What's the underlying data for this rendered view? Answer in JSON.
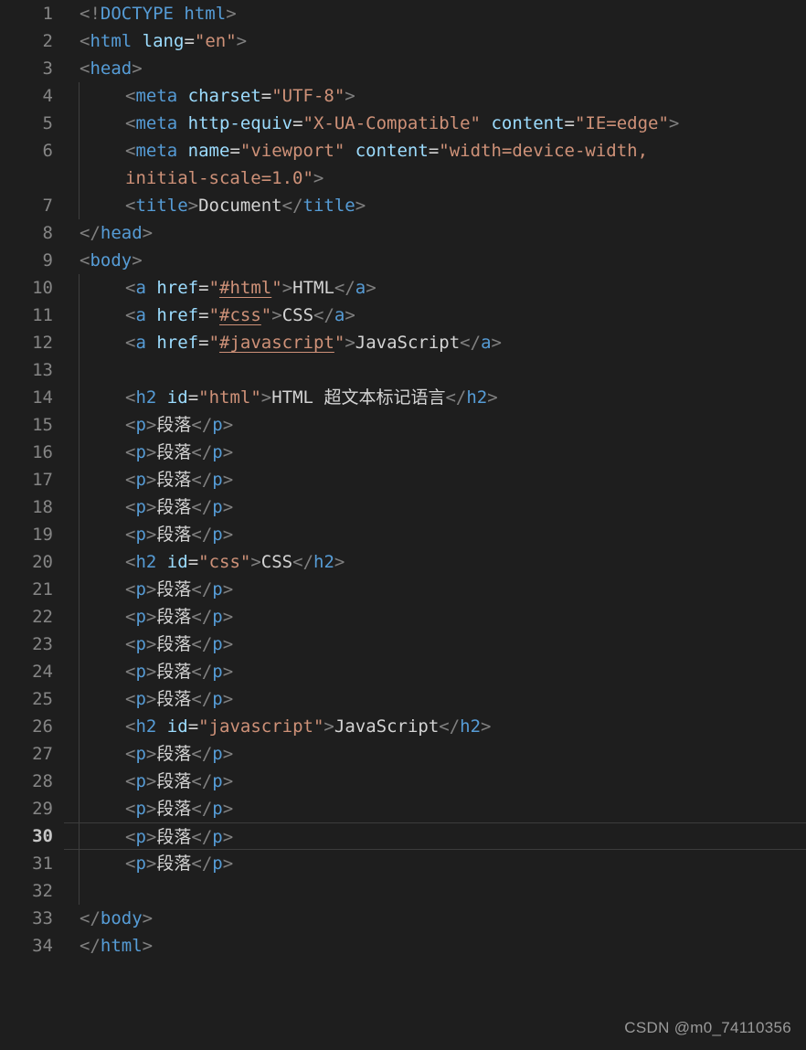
{
  "editor": {
    "language": "html",
    "theme": "dark-plus",
    "background_color": "#1e1e1e",
    "line_number_color": "#858585",
    "active_line_number_color": "#c6c6c6",
    "active_line": 30,
    "total_lines": 34,
    "indent_guide_color": "#404040",
    "colors": {
      "punctuation": "#808080",
      "tag": "#569cd6",
      "attribute": "#9cdcfe",
      "string": "#ce9178",
      "text": "#d4d4d4"
    }
  },
  "watermark": {
    "text": "CSDN @m0_74110356"
  },
  "lines": [
    {
      "n": "1",
      "indent": 0,
      "text": "<!DOCTYPE html>"
    },
    {
      "n": "2",
      "indent": 0,
      "text": "<html lang=\"en\">"
    },
    {
      "n": "3",
      "indent": 0,
      "text": "<head>"
    },
    {
      "n": "4",
      "indent": 1,
      "text": "    <meta charset=\"UTF-8\">"
    },
    {
      "n": "5",
      "indent": 1,
      "text": "    <meta http-equiv=\"X-UA-Compatible\" content=\"IE=edge\">"
    },
    {
      "n": "6",
      "indent": 1,
      "text": "    <meta name=\"viewport\" content=\"width=device-width, initial-scale=1.0\">",
      "wrapped": true,
      "wrap_part_1": "    <meta name=\"viewport\" content=\"width=device-width,",
      "wrap_part_2": "initial-scale=1.0\">"
    },
    {
      "n": "7",
      "indent": 1,
      "text": "    <title>Document</title>"
    },
    {
      "n": "8",
      "indent": 0,
      "text": "</head>"
    },
    {
      "n": "9",
      "indent": 0,
      "text": "<body>"
    },
    {
      "n": "10",
      "indent": 1,
      "text": "    <a href=\"#html\">HTML</a>"
    },
    {
      "n": "11",
      "indent": 1,
      "text": "    <a href=\"#css\">CSS</a>"
    },
    {
      "n": "12",
      "indent": 1,
      "text": "    <a href=\"#javascript\">JavaScript</a>"
    },
    {
      "n": "13",
      "indent": 1,
      "text": ""
    },
    {
      "n": "14",
      "indent": 1,
      "text": "    <h2 id=\"html\">HTML 超文本标记语言</h2>"
    },
    {
      "n": "15",
      "indent": 1,
      "text": "    <p>段落</p>"
    },
    {
      "n": "16",
      "indent": 1,
      "text": "    <p>段落</p>"
    },
    {
      "n": "17",
      "indent": 1,
      "text": "    <p>段落</p>"
    },
    {
      "n": "18",
      "indent": 1,
      "text": "    <p>段落</p>"
    },
    {
      "n": "19",
      "indent": 1,
      "text": "    <p>段落</p>"
    },
    {
      "n": "20",
      "indent": 1,
      "text": "    <h2 id=\"css\">CSS</h2>"
    },
    {
      "n": "21",
      "indent": 1,
      "text": "    <p>段落</p>"
    },
    {
      "n": "22",
      "indent": 1,
      "text": "    <p>段落</p>"
    },
    {
      "n": "23",
      "indent": 1,
      "text": "    <p>段落</p>"
    },
    {
      "n": "24",
      "indent": 1,
      "text": "    <p>段落</p>"
    },
    {
      "n": "25",
      "indent": 1,
      "text": "    <p>段落</p>"
    },
    {
      "n": "26",
      "indent": 1,
      "text": "    <h2 id=\"javascript\">JavaScript</h2>"
    },
    {
      "n": "27",
      "indent": 1,
      "text": "    <p>段落</p>"
    },
    {
      "n": "28",
      "indent": 1,
      "text": "    <p>段落</p>"
    },
    {
      "n": "29",
      "indent": 1,
      "text": "    <p>段落</p>"
    },
    {
      "n": "30",
      "indent": 1,
      "text": "    <p>段落</p>"
    },
    {
      "n": "31",
      "indent": 1,
      "text": "    <p>段落</p>"
    },
    {
      "n": "32",
      "indent": 1,
      "text": ""
    },
    {
      "n": "33",
      "indent": 0,
      "text": "</body>"
    },
    {
      "n": "34",
      "indent": 0,
      "text": "</html>"
    }
  ],
  "tokens": {
    "l1": [
      [
        "t-punc",
        "<!"
      ],
      [
        "t-doctype",
        "DOCTYPE"
      ],
      [
        "t-text",
        " "
      ],
      [
        "t-tag",
        "html"
      ],
      [
        "t-punc",
        ">"
      ]
    ],
    "l2": [
      [
        "t-punc",
        "<"
      ],
      [
        "t-tag",
        "html"
      ],
      [
        "t-text",
        " "
      ],
      [
        "t-attr",
        "lang"
      ],
      [
        "t-eq",
        "="
      ],
      [
        "t-str",
        "\"en\""
      ],
      [
        "t-punc",
        ">"
      ]
    ],
    "l3": [
      [
        "t-punc",
        "<"
      ],
      [
        "t-tag",
        "head"
      ],
      [
        "t-punc",
        ">"
      ]
    ],
    "l4": [
      [
        "t-punc",
        "<"
      ],
      [
        "t-tag",
        "meta"
      ],
      [
        "t-text",
        " "
      ],
      [
        "t-attr",
        "charset"
      ],
      [
        "t-eq",
        "="
      ],
      [
        "t-str",
        "\"UTF-8\""
      ],
      [
        "t-punc",
        ">"
      ]
    ],
    "l5": [
      [
        "t-punc",
        "<"
      ],
      [
        "t-tag",
        "meta"
      ],
      [
        "t-text",
        " "
      ],
      [
        "t-attr",
        "http-equiv"
      ],
      [
        "t-eq",
        "="
      ],
      [
        "t-str",
        "\"X-UA-Compatible\""
      ],
      [
        "t-text",
        " "
      ],
      [
        "t-attr",
        "content"
      ],
      [
        "t-eq",
        "="
      ],
      [
        "t-str",
        "\"IE=edge\""
      ],
      [
        "t-punc",
        ">"
      ]
    ],
    "l6a": [
      [
        "t-punc",
        "<"
      ],
      [
        "t-tag",
        "meta"
      ],
      [
        "t-text",
        " "
      ],
      [
        "t-attr",
        "name"
      ],
      [
        "t-eq",
        "="
      ],
      [
        "t-str",
        "\"viewport\""
      ],
      [
        "t-text",
        " "
      ],
      [
        "t-attr",
        "content"
      ],
      [
        "t-eq",
        "="
      ],
      [
        "t-str",
        "\"width=device-width,"
      ]
    ],
    "l6b": [
      [
        "t-str",
        "initial-scale=1.0\""
      ],
      [
        "t-punc",
        ">"
      ]
    ],
    "l7": [
      [
        "t-punc",
        "<"
      ],
      [
        "t-tag",
        "title"
      ],
      [
        "t-punc",
        ">"
      ],
      [
        "t-text",
        "Document"
      ],
      [
        "t-punc",
        "</"
      ],
      [
        "t-tag",
        "title"
      ],
      [
        "t-punc",
        ">"
      ]
    ],
    "l8": [
      [
        "t-punc",
        "</"
      ],
      [
        "t-tag",
        "head"
      ],
      [
        "t-punc",
        ">"
      ]
    ],
    "l9": [
      [
        "t-punc",
        "<"
      ],
      [
        "t-tag",
        "body"
      ],
      [
        "t-punc",
        ">"
      ]
    ],
    "l10": [
      [
        "t-punc",
        "<"
      ],
      [
        "t-tag",
        "a"
      ],
      [
        "t-text",
        " "
      ],
      [
        "t-attr",
        "href"
      ],
      [
        "t-eq",
        "="
      ],
      [
        "t-str",
        "\""
      ],
      [
        "t-link",
        "#html"
      ],
      [
        "t-str",
        "\""
      ],
      [
        "t-punc",
        ">"
      ],
      [
        "t-text",
        "HTML"
      ],
      [
        "t-punc",
        "</"
      ],
      [
        "t-tag",
        "a"
      ],
      [
        "t-punc",
        ">"
      ]
    ],
    "l11": [
      [
        "t-punc",
        "<"
      ],
      [
        "t-tag",
        "a"
      ],
      [
        "t-text",
        " "
      ],
      [
        "t-attr",
        "href"
      ],
      [
        "t-eq",
        "="
      ],
      [
        "t-str",
        "\""
      ],
      [
        "t-link",
        "#css"
      ],
      [
        "t-str",
        "\""
      ],
      [
        "t-punc",
        ">"
      ],
      [
        "t-text",
        "CSS"
      ],
      [
        "t-punc",
        "</"
      ],
      [
        "t-tag",
        "a"
      ],
      [
        "t-punc",
        ">"
      ]
    ],
    "l12": [
      [
        "t-punc",
        "<"
      ],
      [
        "t-tag",
        "a"
      ],
      [
        "t-text",
        " "
      ],
      [
        "t-attr",
        "href"
      ],
      [
        "t-eq",
        "="
      ],
      [
        "t-str",
        "\""
      ],
      [
        "t-link",
        "#javascript"
      ],
      [
        "t-str",
        "\""
      ],
      [
        "t-punc",
        ">"
      ],
      [
        "t-text",
        "JavaScript"
      ],
      [
        "t-punc",
        "</"
      ],
      [
        "t-tag",
        "a"
      ],
      [
        "t-punc",
        ">"
      ]
    ],
    "l14": [
      [
        "t-punc",
        "<"
      ],
      [
        "t-tag",
        "h2"
      ],
      [
        "t-text",
        " "
      ],
      [
        "t-attr",
        "id"
      ],
      [
        "t-eq",
        "="
      ],
      [
        "t-str",
        "\"html\""
      ],
      [
        "t-punc",
        ">"
      ],
      [
        "t-text",
        "HTML "
      ],
      [
        "t-text cjk",
        "超文本标记语言"
      ],
      [
        "t-punc",
        "</"
      ],
      [
        "t-tag",
        "h2"
      ],
      [
        "t-punc",
        ">"
      ]
    ],
    "l20": [
      [
        "t-punc",
        "<"
      ],
      [
        "t-tag",
        "h2"
      ],
      [
        "t-text",
        " "
      ],
      [
        "t-attr",
        "id"
      ],
      [
        "t-eq",
        "="
      ],
      [
        "t-str",
        "\"css\""
      ],
      [
        "t-punc",
        ">"
      ],
      [
        "t-text",
        "CSS"
      ],
      [
        "t-punc",
        "</"
      ],
      [
        "t-tag",
        "h2"
      ],
      [
        "t-punc",
        ">"
      ]
    ],
    "l26": [
      [
        "t-punc",
        "<"
      ],
      [
        "t-tag",
        "h2"
      ],
      [
        "t-text",
        " "
      ],
      [
        "t-attr",
        "id"
      ],
      [
        "t-eq",
        "="
      ],
      [
        "t-str",
        "\"javascript\""
      ],
      [
        "t-punc",
        ">"
      ],
      [
        "t-text",
        "JavaScript"
      ],
      [
        "t-punc",
        "</"
      ],
      [
        "t-tag",
        "h2"
      ],
      [
        "t-punc",
        ">"
      ]
    ],
    "p": [
      [
        "t-punc",
        "<"
      ],
      [
        "t-tag",
        "p"
      ],
      [
        "t-punc",
        ">"
      ],
      [
        "t-text cjk",
        "段落"
      ],
      [
        "t-punc",
        "</"
      ],
      [
        "t-tag",
        "p"
      ],
      [
        "t-punc",
        ">"
      ]
    ],
    "l33": [
      [
        "t-punc",
        "</"
      ],
      [
        "t-tag",
        "body"
      ],
      [
        "t-punc",
        ">"
      ]
    ],
    "l34": [
      [
        "t-punc",
        "</"
      ],
      [
        "t-tag",
        "html"
      ],
      [
        "t-punc",
        ">"
      ]
    ]
  },
  "line_token_map": {
    "1": "l1",
    "2": "l2",
    "3": "l3",
    "4": "l4",
    "5": "l5",
    "6": "l6a",
    "7": "l7",
    "8": "l8",
    "9": "l9",
    "10": "l10",
    "11": "l11",
    "12": "l12",
    "13": null,
    "14": "l14",
    "15": "p",
    "16": "p",
    "17": "p",
    "18": "p",
    "19": "p",
    "20": "l20",
    "21": "p",
    "22": "p",
    "23": "p",
    "24": "p",
    "25": "p",
    "26": "l26",
    "27": "p",
    "28": "p",
    "29": "p",
    "30": "p",
    "31": "p",
    "32": null,
    "33": "l33",
    "34": "l34"
  }
}
